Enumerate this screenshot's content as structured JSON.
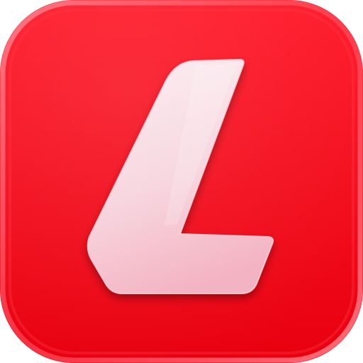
{
  "icon": {
    "name": "app-icon",
    "glyph": "letter-l-logo-icon",
    "colors": {
      "background_top": "#ff1a2a",
      "background_bottom": "#e8000f",
      "rim_highlight": "#ff7a86",
      "glyph_light": "#fbeef2",
      "glyph_shade": "#f4b3c2",
      "glyph_edge": "#ffd7df"
    }
  }
}
